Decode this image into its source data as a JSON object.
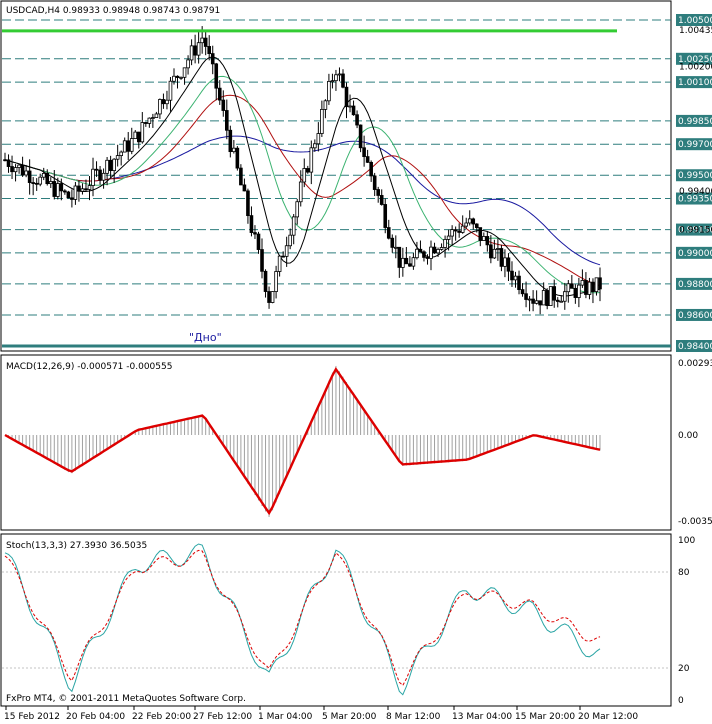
{
  "colors": {
    "price_up": "#000000",
    "ma_blue": "#1a1aa0",
    "ma_red": "#b01010",
    "ma_green": "#3cb371",
    "ma_black": "#000000",
    "hline_green": "#33cc33",
    "level_line": "#2e7d7d",
    "macd_signal": "#dd0000",
    "macd_hist": "#a0a0a0",
    "stoch_main": "#2aa5a5",
    "stoch_signal": "#dd0000"
  },
  "price_panel": {
    "title": "USDCAD,H4  0.98933 0.98948 0.98743 0.98791",
    "annotation": "\"Дно\"",
    "level_labels": [
      "1.00500",
      "1.00250",
      "1.00100",
      "0.99850",
      "0.99700",
      "0.99500",
      "0.99350",
      "0.99150",
      "0.99000",
      "0.98800",
      "0.98600",
      "0.98400"
    ],
    "plain_labels": [
      "1.00435",
      "1.00200",
      "0.99400",
      "0.99150"
    ]
  },
  "macd_panel": {
    "title": "MACD(12,26,9) -0.000571 -0.000555",
    "labels": [
      "0.00293",
      "0.00",
      "-0.00350"
    ]
  },
  "stoch_panel": {
    "title": "Stoch(13,3,3) 27.3930 36.5035",
    "labels": [
      "100",
      "80",
      "20",
      "0"
    ],
    "copyright": "FxPro MT4, © 2001-2011 MetaQuotes Software Corp."
  },
  "x_axis": {
    "labels": [
      "15 Feb 2012",
      "20 Feb 04:00",
      "22 Feb 20:00",
      "27 Feb 12:00",
      "1 Mar 04:00",
      "5 Mar 20:00",
      "8 Mar 12:00",
      "13 Mar 04:00",
      "15 Mar 20:00",
      "20 Mar 12:00"
    ]
  },
  "chart_data": [
    {
      "type": "line",
      "title": "USDCAD,H4  0.98933 0.98948 0.98743 0.98791",
      "x": [
        "15 Feb 2012",
        "20 Feb 04:00",
        "22 Feb 20:00",
        "27 Feb 12:00",
        "1 Mar 04:00",
        "5 Mar 20:00",
        "8 Mar 12:00",
        "13 Mar 04:00",
        "15 Mar 20:00",
        "20 Mar 12:00"
      ],
      "series": [
        {
          "values": [
            0.996,
            0.9935,
            0.9975,
            1.004,
            0.987,
            1.002,
            0.989,
            0.992,
            0.987,
            0.9879
          ]
        }
      ],
      "horizontal_lines": [
        1.0043,
        0.984
      ],
      "ylim": [
        0.984,
        1.006
      ]
    },
    {
      "type": "line",
      "title": "MACD(12,26,9) -0.000571 -0.000555",
      "series": [
        {
          "values": [
            0.0,
            -0.0015,
            0.0002,
            0.0008,
            -0.0032,
            0.0027,
            -0.0012,
            -0.001,
            0.0,
            -0.0006
          ]
        }
      ],
      "ylim": [
        -0.0035,
        0.00293
      ]
    },
    {
      "type": "line",
      "title": "Stoch(13,3,3) 27.3930 36.5035",
      "series": [
        {
          "values": [
            92,
            10,
            85,
            92,
            12,
            95,
            8,
            70,
            55,
            27.4
          ]
        },
        {
          "values": [
            90,
            15,
            83,
            90,
            16,
            93,
            12,
            68,
            58,
            36.5
          ]
        }
      ],
      "ylim": [
        0,
        100
      ]
    }
  ]
}
